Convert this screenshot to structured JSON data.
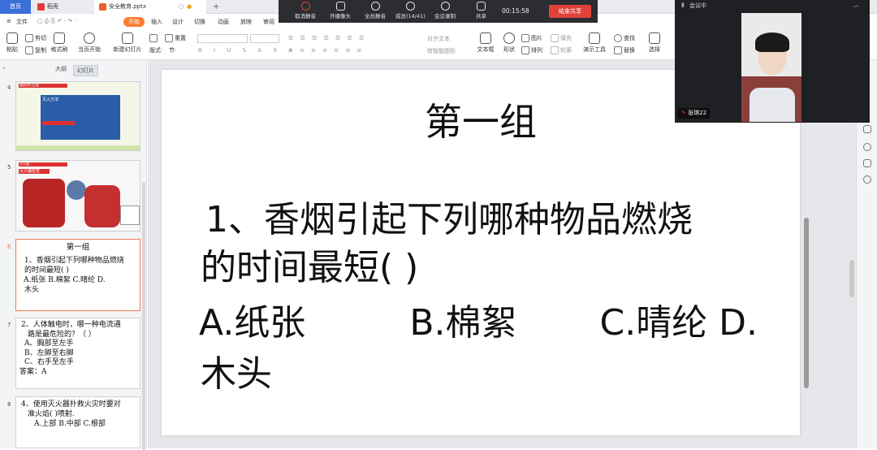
{
  "tabs": {
    "home": "首页",
    "doc": "稻壳",
    "ppt": "安全教育.pptx",
    "add": "+"
  },
  "menu": {
    "file": "文件",
    "items": [
      "开始",
      "插入",
      "设计",
      "切换",
      "动画",
      "放映",
      "审阅"
    ]
  },
  "meeting": {
    "mute_all_off": "取消静音",
    "camera": "开摄像头",
    "mute_all": "全员静音",
    "members": "成员(14/41)",
    "record": "会议录制",
    "share": "共享",
    "timer": "00:15:58",
    "end_share": "结束共享"
  },
  "ribbon": {
    "paste": "粘贴",
    "cut": "剪切",
    "copy": "复制",
    "format_painter": "格式刷",
    "play_current": "当页开始",
    "new_slide": "新建幻灯片",
    "layout": "版式",
    "section": "节",
    "reset": "重置",
    "text_box": "文本框",
    "shape": "形状",
    "arrange": "排列",
    "picture": "图片",
    "fill": "填充",
    "outline": "轮廓",
    "presenter": "演示工具",
    "find": "查找",
    "replace": "替换",
    "select": "选择",
    "align_text": "对齐文本",
    "smart_shape": "转智能图形"
  },
  "sidebar": {
    "tab_outline": "大纲",
    "tab_slides": "幻灯片",
    "slides": [
      {
        "num": "4",
        "head": "请同学们注意",
        "sub": "注意安全",
        "body": "灭火方法"
      },
      {
        "num": "5",
        "head": "灭火器检查",
        "sub": "灭火器"
      },
      {
        "num": "6",
        "title": "第一组",
        "lines": [
          "1、香烟引起下列哪种物品燃烧",
          "的时间最短(    )",
          "A.纸张    B.棉絮    C.晴纶 D.",
          "木头"
        ]
      },
      {
        "num": "7",
        "lines": [
          "2、人体触电时，哪一种电流通",
          "路是最危险的？（  ）",
          "A、胸部至左手",
          "B、左脚至右脚",
          "C、右手至左手",
          "答案：A"
        ]
      },
      {
        "num": "8",
        "lines": [
          "4、使用灭火器扑救火灾时要对",
          "准火焰(    )喷射.",
          "A.上部 B.中部 C.根部"
        ]
      }
    ]
  },
  "slide": {
    "title": "第一组",
    "q1": "1、香烟引起下列哪种物品燃烧",
    "q2": "的时间最短(      )",
    "opt_a": "A.纸张",
    "opt_b": "B.棉絮",
    "opt_c": "C.晴纶 D.",
    "opt_d": "木头"
  },
  "video": {
    "header": "会议中",
    "name": "张琪22"
  },
  "colors": {
    "accent": "#ff7a2f",
    "home_tab": "#3b6fd8",
    "end_button": "#e0423a",
    "meeting_bar": "#2b2d31",
    "selected_thumb": "#f07a55"
  }
}
